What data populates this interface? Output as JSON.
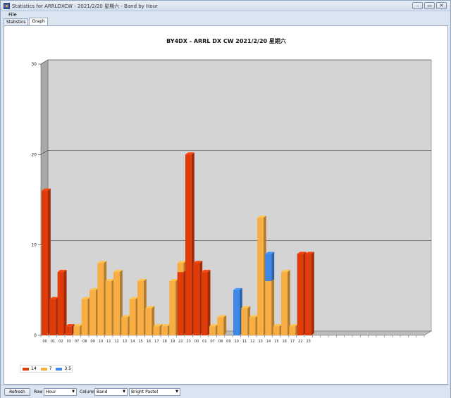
{
  "window": {
    "title": "Statistics for ARRLDXCW - 2021/2/20 星期六 - Band by Hour",
    "buttons": {
      "minimize": "–",
      "restore": "▭",
      "close": "✕"
    }
  },
  "menu": {
    "file": "File"
  },
  "tabs": [
    {
      "label": "Statistics"
    },
    {
      "label": "Graph"
    }
  ],
  "chart_data": {
    "type": "bar",
    "title": "BY4DX - ARRL DX CW 2021/2/20 星期六",
    "ylim": [
      0,
      30
    ],
    "yticks": [
      "0",
      "10",
      "20",
      "30"
    ],
    "grid": true,
    "stacked": true,
    "legend_position": "bottom-left",
    "categories": [
      "00",
      "01",
      "02",
      "03",
      "07",
      "08",
      "09",
      "10",
      "11",
      "12",
      "13",
      "14",
      "15",
      "16",
      "17",
      "18",
      "19",
      "22",
      "23",
      "00",
      "01",
      "07",
      "08",
      "09",
      "10",
      "11",
      "12",
      "13",
      "14",
      "15",
      "16",
      "17",
      "22",
      "23"
    ],
    "series": [
      {
        "name": "14",
        "color": "#e03c0a",
        "values": [
          16,
          4,
          7,
          1,
          0,
          0,
          0,
          0,
          0,
          0,
          0,
          0,
          0,
          0,
          0,
          0,
          0,
          7,
          20,
          8,
          7,
          0,
          0,
          0,
          0,
          0,
          0,
          0,
          0,
          0,
          0,
          0,
          9,
          9
        ]
      },
      {
        "name": "7",
        "color": "#f8ae42",
        "values": [
          0,
          0,
          0,
          0,
          1,
          4,
          5,
          8,
          6,
          7,
          2,
          4,
          6,
          3,
          1,
          1,
          6,
          1,
          0,
          0,
          0,
          1,
          2,
          0,
          0,
          3,
          2,
          13,
          6,
          1,
          7,
          1,
          0,
          0
        ]
      },
      {
        "name": "3.5",
        "color": "#3f88e8",
        "values": [
          0,
          0,
          0,
          0,
          0,
          0,
          0,
          0,
          0,
          0,
          0,
          0,
          0,
          0,
          0,
          0,
          0,
          0,
          0,
          0,
          0,
          0,
          0,
          0,
          5,
          0,
          0,
          0,
          3,
          0,
          0,
          0,
          0,
          0
        ]
      }
    ],
    "empty_slots": 14
  },
  "controls": {
    "refresh": "Refresh",
    "row_label": "Row",
    "row_value": "Hour",
    "column_label": "Column",
    "column_value": "Band",
    "palette_value": "Bright Pastel"
  }
}
